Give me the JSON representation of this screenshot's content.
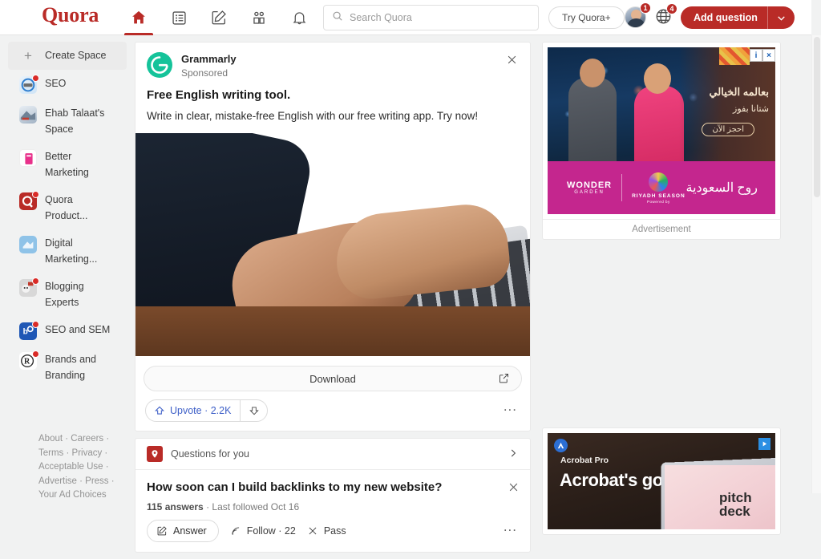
{
  "theme": {
    "brand_red": "#b92b27",
    "upvote_blue": "#3c5ec7",
    "page_bg": "#f1f2f2"
  },
  "header": {
    "brand": "Quora",
    "nav": [
      {
        "name": "home-icon",
        "label": "Home",
        "active": true
      },
      {
        "name": "answer-list-icon",
        "label": "Following",
        "active": false
      },
      {
        "name": "pencil-square-icon",
        "label": "Answer",
        "active": false
      },
      {
        "name": "spaces-icon",
        "label": "Spaces",
        "active": false
      },
      {
        "name": "bell-icon",
        "label": "Notifications",
        "active": false
      }
    ],
    "search": {
      "placeholder": "Search Quora",
      "value": ""
    },
    "try_quora_plus": "Try Quora+",
    "avatar_badge": "1",
    "globe_badge": "4",
    "add_question": "Add question"
  },
  "sidebar": {
    "create_space": "Create Space",
    "items": [
      {
        "label": "SEO",
        "icon": "seo-space-icon",
        "has_badge": true
      },
      {
        "label": "Ehab Talaat's Space",
        "icon": "ehab-talaat-space-icon",
        "has_badge": false
      },
      {
        "label": "Better Marketing",
        "icon": "better-marketing-icon",
        "has_badge": false
      },
      {
        "label": "Quora Product...",
        "icon": "quora-product-icon",
        "has_badge": true
      },
      {
        "label": "Digital Marketing...",
        "icon": "digital-marketing-icon",
        "has_badge": false
      },
      {
        "label": "Blogging Experts",
        "icon": "blogging-experts-icon",
        "has_badge": true
      },
      {
        "label": "SEO and SEM",
        "icon": "seo-and-sem-icon",
        "has_badge": true
      },
      {
        "label": "Brands and Branding",
        "icon": "brands-and-branding-icon",
        "has_badge": true
      }
    ],
    "footer_links": [
      "About",
      "Careers",
      "Terms",
      "Privacy",
      "Acceptable Use",
      "Advertise",
      "Press",
      "Your Ad Choices"
    ],
    "footer_text": "About · Careers · Terms · Privacy · Acceptable Use · Advertise · Press · Your Ad Choices"
  },
  "feed": {
    "ad": {
      "advertiser": "Grammarly",
      "sponsored_label": "Sponsored",
      "logo_letter": "G",
      "title": "Free English writing tool.",
      "subtitle": "Write in clear, mistake-free English with our free writing app. Try now!",
      "image_alt": "Hands typing on a laptop keyboard",
      "cta": "Download",
      "upvote_label": "Upvote",
      "upvote_count": "2.2K",
      "upvote_text": "Upvote · 2.2K",
      "more_label": "..."
    },
    "questions_for_you": {
      "section_label": "Questions for you",
      "question": "How soon can I build backlinks to my new website?",
      "answers_count": "115 answers",
      "last_followed": "Last followed Oct 16",
      "meta_separator": " · ",
      "answer_button": "Answer",
      "follow_button": "Follow",
      "follow_count": "22",
      "follow_text": "Follow · 22",
      "pass_button": "Pass",
      "more_label": "..."
    }
  },
  "right_column": {
    "ad_top": {
      "headline_ar": "بعالمه الخيالي",
      "subline_ar": "شتانا بفوز",
      "cta_ar": "احجز الآن",
      "brand_left": "WONDER",
      "brand_left_sub": "GARDEN",
      "brand_mid": "RIYADH SEASON",
      "brand_mid_sub": "Powered by",
      "brand_right_ar": "روح السعودية",
      "label": "Advertisement"
    },
    "ad_bottom": {
      "product": "Acrobat Pro",
      "headline": "Acrobat's got it.",
      "deck_text": "pitch deck"
    }
  }
}
